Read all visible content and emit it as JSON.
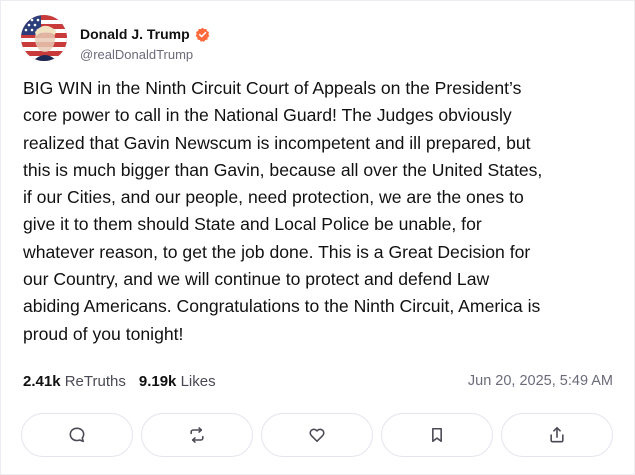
{
  "post": {
    "author": {
      "display_name": "Donald J. Trump",
      "handle": "@realDonaldTrump",
      "verified_icon": "verified-badge-icon",
      "verified_color": "#ff6a3d"
    },
    "text": "BIG WIN in the Ninth Circuit Court of Appeals on the President’s\ncore power to call in the National Guard! The Judges obviously\nrealized that Gavin Newscum is incompetent and ill prepared, but\nthis is much bigger than Gavin, because all over the United States,\nif our Cities, and our people, need protection, we are the ones to\ngive it to them should State and Local Police be unable, for\nwhatever reason, to get the job done. This is a Great Decision for\nour Country, and we will continue to protect and defend Law\nabiding Americans. Congratulations to the Ninth Circuit, America is\nproud of you tonight!",
    "stats": {
      "retruths_count": "2.41k",
      "retruths_label": "ReTruths",
      "likes_count": "9.19k",
      "likes_label": "Likes"
    },
    "timestamp": "Jun 20, 2025, 5:49 AM",
    "actions": [
      {
        "icon": "comment-icon"
      },
      {
        "icon": "retruth-icon"
      },
      {
        "icon": "like-heart-icon"
      },
      {
        "icon": "bookmark-icon"
      },
      {
        "icon": "share-icon"
      }
    ]
  },
  "colors": {
    "text": "#111111",
    "muted": "#6b6b7b",
    "border": "#e4e4ee",
    "icon": "#4a4a55"
  }
}
